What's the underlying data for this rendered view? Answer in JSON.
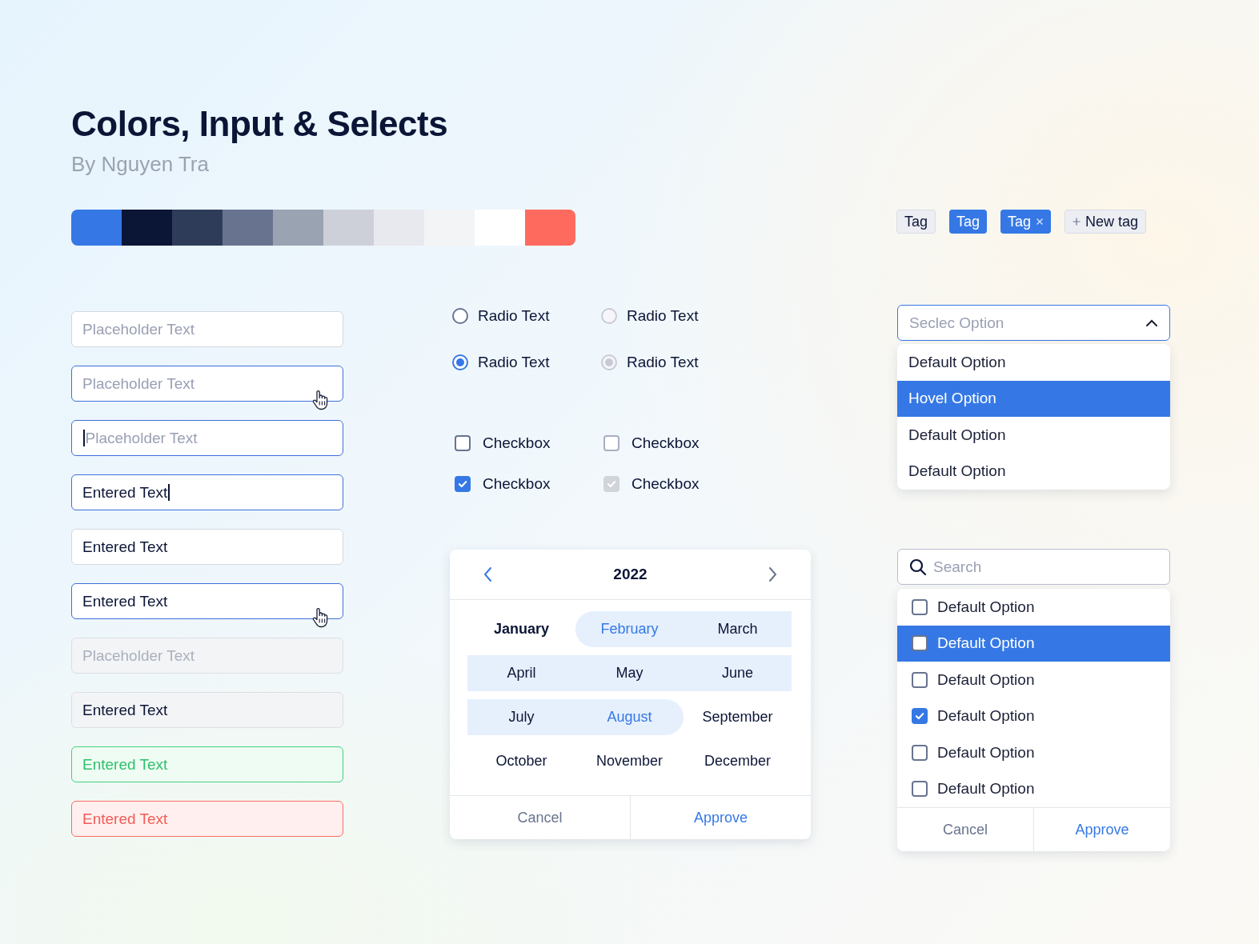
{
  "title": "Colors, Input & Selects",
  "subtitle": "By Nguyen Tra",
  "palette": [
    {
      "color": "#3578e5"
    },
    {
      "color": "#0b1536"
    },
    {
      "color": "#2e3c5a"
    },
    {
      "color": "#68748f"
    },
    {
      "color": "#9aa3b2"
    },
    {
      "color": "#cdd0d8"
    },
    {
      "color": "#e8e9ee"
    },
    {
      "color": "#f3f4f6"
    },
    {
      "color": "#ffffff"
    },
    {
      "color": "#fe6b5e"
    }
  ],
  "tags": [
    {
      "label": "Tag",
      "kind": "default"
    },
    {
      "label": "Tag",
      "kind": "active"
    },
    {
      "label": "Tag",
      "kind": "removable"
    },
    {
      "label": "New tag",
      "kind": "add"
    }
  ],
  "inputs": [
    {
      "placeholder": "Placeholder Text",
      "kind": "default",
      "caret": false
    },
    {
      "placeholder": "Placeholder Text",
      "kind": "hover",
      "caret": false
    },
    {
      "placeholder": "Placeholder Text",
      "kind": "focus",
      "caret": true
    },
    {
      "value": "Entered Text",
      "kind": "focus",
      "caret": true
    },
    {
      "value": "Entered Text",
      "kind": "default",
      "caret": false
    },
    {
      "value": "Entered Text",
      "kind": "hover",
      "caret": false
    },
    {
      "placeholder": "Placeholder Text",
      "kind": "disabled",
      "caret": false
    },
    {
      "value": "Entered Text",
      "kind": "disabled",
      "caret": false
    },
    {
      "value": "Entered Text",
      "kind": "success",
      "caret": false
    },
    {
      "value": "Entered Text",
      "kind": "error",
      "caret": false
    }
  ],
  "radios": [
    {
      "label": "Radio Text",
      "selected": false,
      "disabled": false
    },
    {
      "label": "Radio Text",
      "selected": false,
      "disabled": true
    },
    {
      "label": "Radio Text",
      "selected": true,
      "disabled": false
    },
    {
      "label": "Radio Text",
      "selected": true,
      "disabled": true
    }
  ],
  "checkboxes": [
    {
      "label": "Checkbox",
      "checked": false,
      "disabled": false
    },
    {
      "label": "Checkbox",
      "checked": false,
      "disabled": true
    },
    {
      "label": "Checkbox",
      "checked": true,
      "disabled": false
    },
    {
      "label": "Checkbox",
      "checked": true,
      "disabled": true
    }
  ],
  "calendar": {
    "year": "2022",
    "months": [
      {
        "label": "January",
        "current": true,
        "in_range": false,
        "range_start": false,
        "range_end": false
      },
      {
        "label": "February",
        "current": false,
        "in_range": true,
        "range_start": true,
        "range_end": false
      },
      {
        "label": "March",
        "current": false,
        "in_range": true,
        "range_start": false,
        "range_end": false
      },
      {
        "label": "April",
        "current": false,
        "in_range": true,
        "range_start": false,
        "range_end": false
      },
      {
        "label": "May",
        "current": false,
        "in_range": true,
        "range_start": false,
        "range_end": false
      },
      {
        "label": "June",
        "current": false,
        "in_range": true,
        "range_start": false,
        "range_end": false
      },
      {
        "label": "July",
        "current": false,
        "in_range": true,
        "range_start": false,
        "range_end": false
      },
      {
        "label": "August",
        "current": false,
        "in_range": true,
        "range_start": false,
        "range_end": true
      },
      {
        "label": "September",
        "current": false,
        "in_range": false,
        "range_start": false,
        "range_end": false
      },
      {
        "label": "October",
        "current": false,
        "in_range": false,
        "range_start": false,
        "range_end": false
      },
      {
        "label": "November",
        "current": false,
        "in_range": false,
        "range_start": false,
        "range_end": false
      },
      {
        "label": "December",
        "current": false,
        "in_range": false,
        "range_start": false,
        "range_end": false
      }
    ],
    "cancel": "Cancel",
    "approve": "Approve"
  },
  "select": {
    "placeholder": "Seclec Option",
    "expanded": true,
    "options": [
      {
        "label": "Default Option",
        "selected": false
      },
      {
        "label": "Hovel Option",
        "selected": true
      },
      {
        "label": "Default Option",
        "selected": false
      },
      {
        "label": "Default Option",
        "selected": false
      }
    ]
  },
  "search_select": {
    "placeholder": "Search",
    "options": [
      {
        "label": "Default Option",
        "selected": false,
        "checked": false
      },
      {
        "label": "Default Option",
        "selected": true,
        "checked": false
      },
      {
        "label": "Default Option",
        "selected": false,
        "checked": false
      },
      {
        "label": "Default Option",
        "selected": false,
        "checked": true
      },
      {
        "label": "Default Option",
        "selected": false,
        "checked": false
      },
      {
        "label": "Default Option",
        "selected": false,
        "checked": false
      }
    ],
    "cancel": "Cancel",
    "approve": "Approve"
  }
}
